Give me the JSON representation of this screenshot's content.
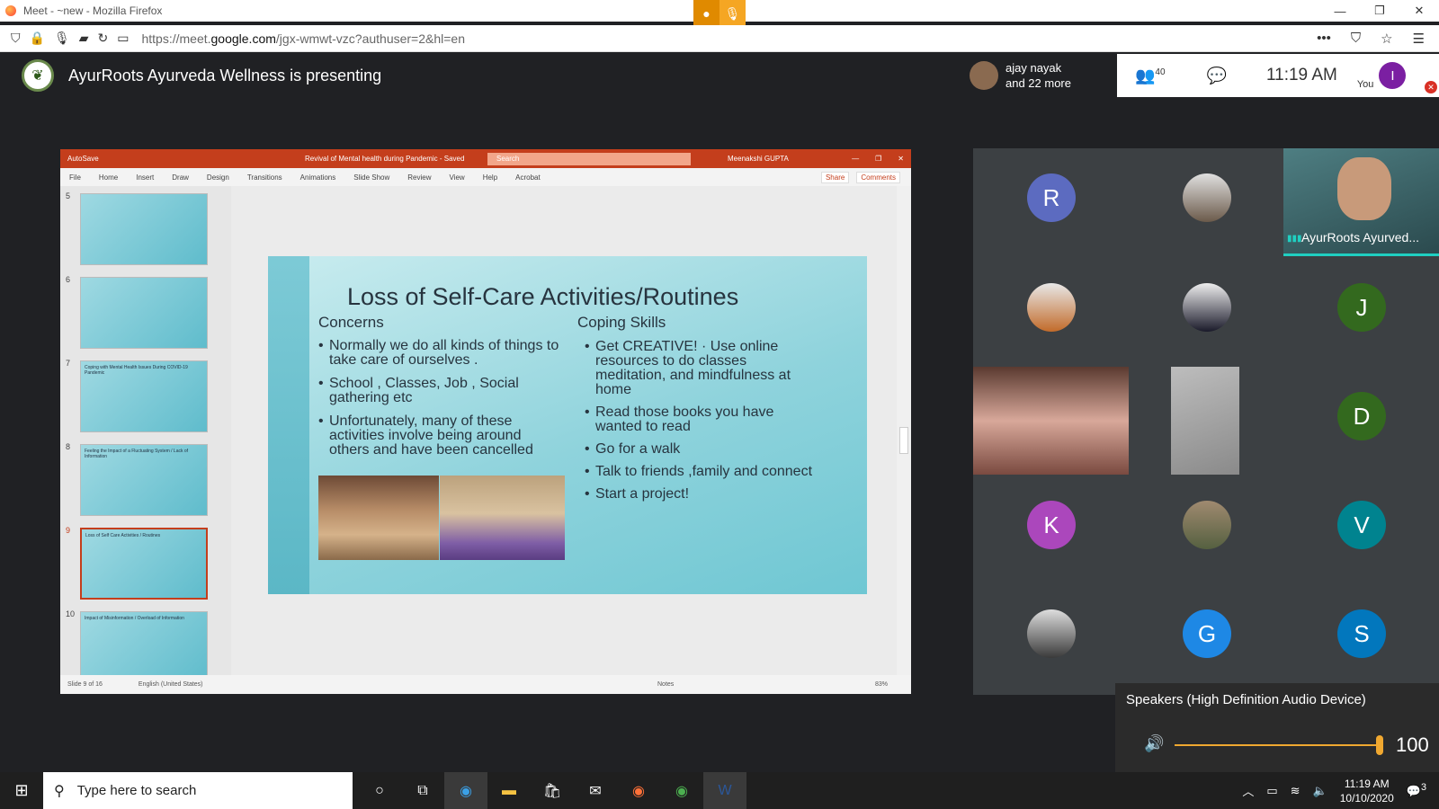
{
  "browser": {
    "title": "Meet - ~new - Mozilla Firefox",
    "url_prefix": "https://meet.",
    "url_domain": "google.com",
    "url_rest": "/jgx-wmwt-vzc?authuser=2&hl=en"
  },
  "meet": {
    "presenting_text": "AyurRoots Ayurveda Wellness is presenting",
    "presenter_name_line1": "ajay nayak",
    "presenter_name_line2": "and 22 more",
    "people_count": "40",
    "time": "11:19 AM",
    "you_label": "You",
    "you_initial": "I"
  },
  "ppt": {
    "autosave": "AutoSave",
    "doc_title": "Revival of Mental health during Pandemic - Saved",
    "search": "Search",
    "user": "Meenakshi GUPTA",
    "menu": [
      "File",
      "Home",
      "Insert",
      "Draw",
      "Design",
      "Transitions",
      "Animations",
      "Slide Show",
      "Review",
      "View",
      "Help",
      "Acrobat"
    ],
    "share": "Share",
    "comments": "Comments",
    "thumbs": [
      {
        "num": "5",
        "title": ""
      },
      {
        "num": "6",
        "title": ""
      },
      {
        "num": "7",
        "title": "Coping with Mental Health Issues During COVID-19 Pandemic"
      },
      {
        "num": "8",
        "title": "Feeling the Impact of a Fluctuating System / Lack of Information"
      },
      {
        "num": "9",
        "title": "Loss of Self Care Activities / Routines"
      },
      {
        "num": "10",
        "title": "Impact of Misinformation / Overload of Information"
      }
    ],
    "status_slide": "Slide 9 of 16",
    "status_lang": "English (United States)",
    "status_notes": "Notes",
    "zoom": "83%"
  },
  "slide": {
    "title": "Loss of Self-Care Activities/Routines",
    "concerns_heading": "Concerns",
    "coping_heading": "Coping Skills",
    "concerns": [
      "Normally we do all kinds of things to take care of ourselves .",
      "School , Classes, Job , Social gathering etc",
      " Unfortunately, many of these activities involve being around others and have been cancelled"
    ],
    "coping": [
      "Get CREATIVE! ·  Use online resources to do classes meditation, and mindfulness at home",
      "Read those books you have wanted to read",
      "Go for a walk",
      "Talk to friends ,family and connect",
      "Start a project!"
    ]
  },
  "participants": {
    "presenter_tile_label": "AyurRoots Ayurved...",
    "initials": [
      {
        "letter": "R",
        "color": "#5c6bc0"
      },
      {
        "letter": "J",
        "color": "#33691e"
      },
      {
        "letter": "D",
        "color": "#33691e"
      },
      {
        "letter": "K",
        "color": "#ab47bc"
      },
      {
        "letter": "V",
        "color": "#00838f"
      },
      {
        "letter": "G",
        "color": "#1e88e5"
      },
      {
        "letter": "S",
        "color": "#0277bd"
      }
    ]
  },
  "speaker": {
    "device": "Speakers (High Definition Audio Device)",
    "volume": "100"
  },
  "taskbar": {
    "search_placeholder": "Type here to search",
    "time": "11:19 AM",
    "date": "10/10/2020",
    "notif_count": "3"
  }
}
